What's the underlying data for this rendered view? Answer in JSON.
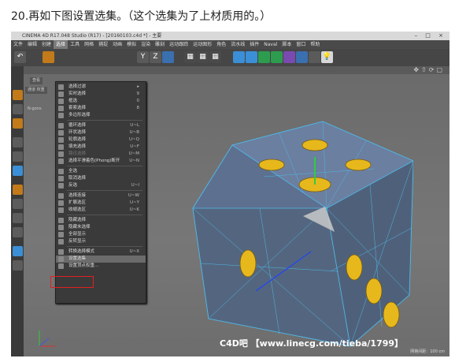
{
  "caption": "20.再如下图设置选集。（这个选集为了上材质用的。）",
  "window": {
    "title": "CINEMA 4D R17.048 Studio (R17) - [20160103.c4d *] - 主要",
    "controls": "– □ ×"
  },
  "menubar": [
    "文件",
    "编辑",
    "创建",
    "选择",
    "工具",
    "网格",
    "捕捉",
    "动画",
    "模拟",
    "渲染",
    "雕刻",
    "运动跟踪",
    "运动图形",
    "角色",
    "流水线",
    "插件",
    "Naval",
    "脚本",
    "窗口",
    "帮助"
  ],
  "menubar_active_index": 3,
  "panel_tabs": [
    "查看",
    "通道 权重"
  ],
  "panel_label": "N-gons",
  "select_menu": [
    {
      "label": "选择过滤",
      "shortcut": "▸",
      "dim": false,
      "icon": "filter-icon"
    },
    {
      "label": "实时选择",
      "shortcut": "9",
      "dim": false,
      "icon": "live-selection-icon"
    },
    {
      "label": "框选",
      "shortcut": "0",
      "dim": false,
      "icon": "rectangle-selection-icon"
    },
    {
      "label": "套索选择",
      "shortcut": "8",
      "dim": false,
      "icon": "lasso-selection-icon"
    },
    {
      "label": "多边形选择",
      "shortcut": "",
      "dim": false,
      "icon": "polygon-selection-icon"
    },
    {
      "sep": true
    },
    {
      "label": "循环选择",
      "shortcut": "U~L",
      "dim": false,
      "icon": "loop-selection-icon"
    },
    {
      "label": "环状选择",
      "shortcut": "U~B",
      "dim": false,
      "icon": "ring-selection-icon"
    },
    {
      "label": "轮廓选择",
      "shortcut": "U~Q",
      "dim": false,
      "icon": "outline-selection-icon"
    },
    {
      "label": "填充选择",
      "shortcut": "U~F",
      "dim": false,
      "icon": "fill-selection-icon"
    },
    {
      "label": "路径选择",
      "shortcut": "U~M",
      "dim": true,
      "icon": "path-selection-icon"
    },
    {
      "label": "选择平滑着色(Phong)断开",
      "shortcut": "U~N",
      "dim": false,
      "icon": "phong-break-icon"
    },
    {
      "sep": true
    },
    {
      "label": "全选",
      "shortcut": "",
      "dim": false,
      "icon": "select-all-icon"
    },
    {
      "label": "取消选择",
      "shortcut": "",
      "dim": false,
      "icon": "deselect-icon"
    },
    {
      "label": "反选",
      "shortcut": "U~I",
      "dim": false,
      "icon": "invert-icon"
    },
    {
      "sep": true
    },
    {
      "label": "选择连接",
      "shortcut": "U~W",
      "dim": false,
      "icon": "select-connected-icon"
    },
    {
      "label": "扩展选区",
      "shortcut": "U~Y",
      "dim": false,
      "icon": "grow-selection-icon"
    },
    {
      "label": "收缩选区",
      "shortcut": "U~K",
      "dim": false,
      "icon": "shrink-selection-icon"
    },
    {
      "sep": true
    },
    {
      "label": "隐藏选择",
      "shortcut": "",
      "dim": false,
      "icon": "hide-selected-icon"
    },
    {
      "label": "隐藏未选择",
      "shortcut": "",
      "dim": false,
      "icon": "hide-unselected-icon"
    },
    {
      "label": "全部显示",
      "shortcut": "",
      "dim": false,
      "icon": "unhide-all-icon"
    },
    {
      "label": "反转显示",
      "shortcut": "",
      "dim": false,
      "icon": "invert-visibility-icon"
    },
    {
      "sep": true
    },
    {
      "label": "转换选择模式",
      "shortcut": "U~X",
      "dim": false,
      "icon": "convert-selection-icon"
    },
    {
      "label": "设置选集",
      "shortcut": "",
      "dim": false,
      "highlight": true,
      "icon": "set-selection-icon"
    },
    {
      "label": "设置顶点权重...",
      "shortcut": "",
      "dim": false,
      "icon": "vertex-weight-icon"
    }
  ],
  "watermark": "C4D吧 【www.linecg.com/tieba/1799】",
  "grid_text": "网格间距：100 cm",
  "colors": {
    "hole": "#e6b81c",
    "mesh": "#5d7090",
    "wire": "#4fb8e8",
    "highlight_box": "#e02020"
  }
}
